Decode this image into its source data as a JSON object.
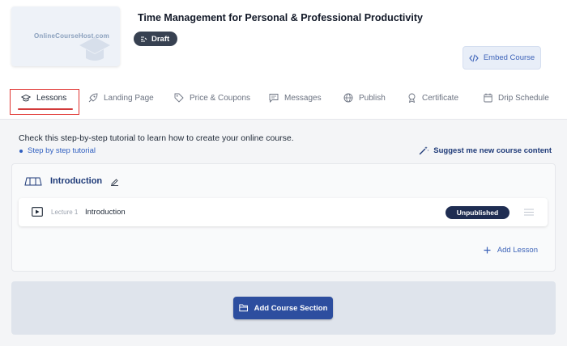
{
  "course": {
    "title": "Time Management for Personal & Professional Productivity",
    "status_badge": "Draft",
    "thumbnail_logo_text": "OnlineCourseHost.com"
  },
  "header": {
    "embed_label": "Embed Course"
  },
  "tabs": [
    {
      "label": "Lessons",
      "icon": "graduation-cap-icon",
      "active": true
    },
    {
      "label": "Landing Page",
      "icon": "rocket-icon",
      "active": false
    },
    {
      "label": "Price & Coupons",
      "icon": "tag-icon",
      "active": false
    },
    {
      "label": "Messages",
      "icon": "message-icon",
      "active": false
    },
    {
      "label": "Publish",
      "icon": "globe-icon",
      "active": false
    },
    {
      "label": "Certificate",
      "icon": "award-icon",
      "active": false
    },
    {
      "label": "Drip Schedule",
      "icon": "calendar-icon",
      "active": false
    }
  ],
  "tutorial": {
    "text": "Check this step-by-step tutorial to learn how to create your online course.",
    "link": "Step by step tutorial",
    "suggest": "Suggest me new course content"
  },
  "section": {
    "title": "Introduction",
    "lectures": [
      {
        "label": "Lecture 1",
        "title": "Introduction",
        "status": "Unpublished"
      }
    ],
    "add_lesson": "Add Lesson"
  },
  "add_section_label": "Add Course Section",
  "colors": {
    "accent": "#2d4e9f",
    "link": "#2f5fc0",
    "active_highlight": "#e0322f",
    "badge_dark": "#1f2d52"
  }
}
